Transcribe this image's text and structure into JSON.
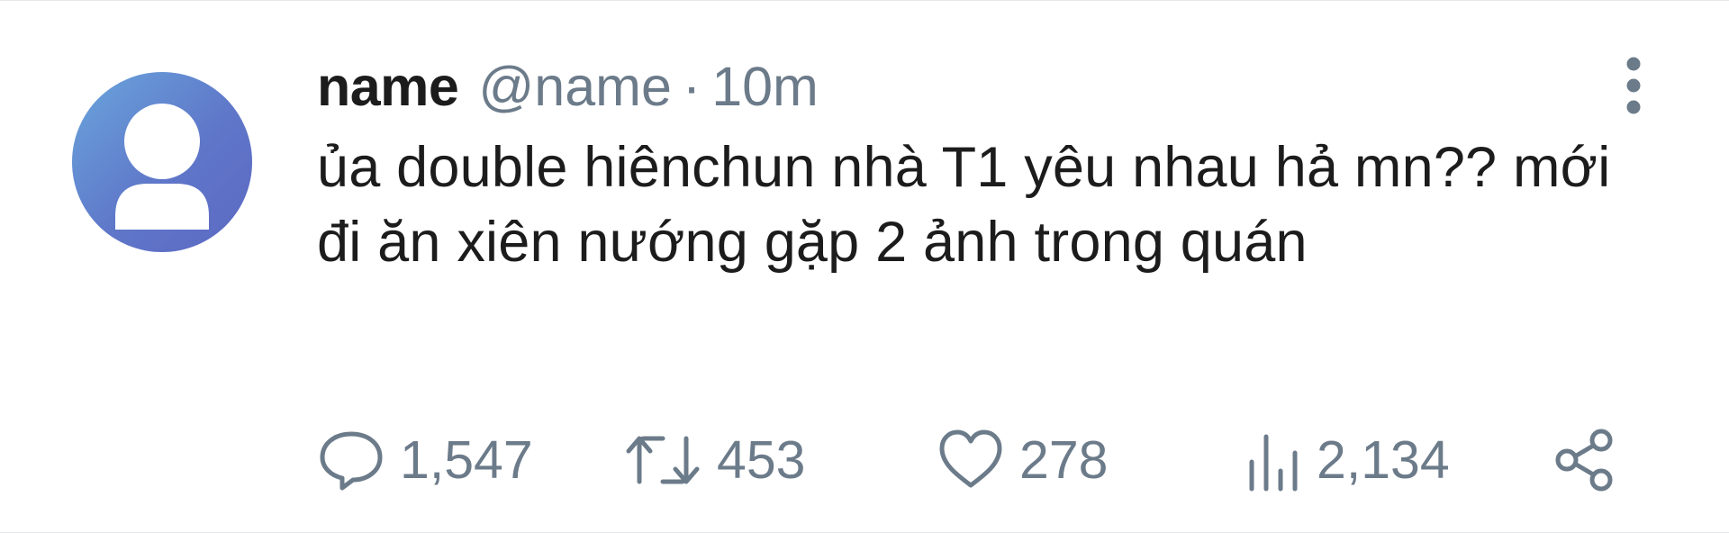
{
  "tweet": {
    "display_name": "name",
    "handle": "@name",
    "separator": "·",
    "time": "10m",
    "text": "ủa double hiênchun nhà T1 yêu nhau hả mn?? mới đi ăn xiên nướng gặp 2 ảnh trong quán"
  },
  "actions": {
    "replies": "1,547",
    "retweets": "453",
    "likes": "278",
    "views": "2,134"
  },
  "icons": {
    "avatar": "default-user-avatar",
    "more": "more-vertical-icon",
    "reply": "reply-bubble-icon",
    "retweet": "retweet-icon",
    "like": "heart-icon",
    "views": "bar-chart-icon",
    "share": "share-icon"
  },
  "colors": {
    "text": "#1c1c1c",
    "muted": "#6c7b8a",
    "avatar_start": "#6aa6dc",
    "avatar_end": "#5c68c2"
  }
}
